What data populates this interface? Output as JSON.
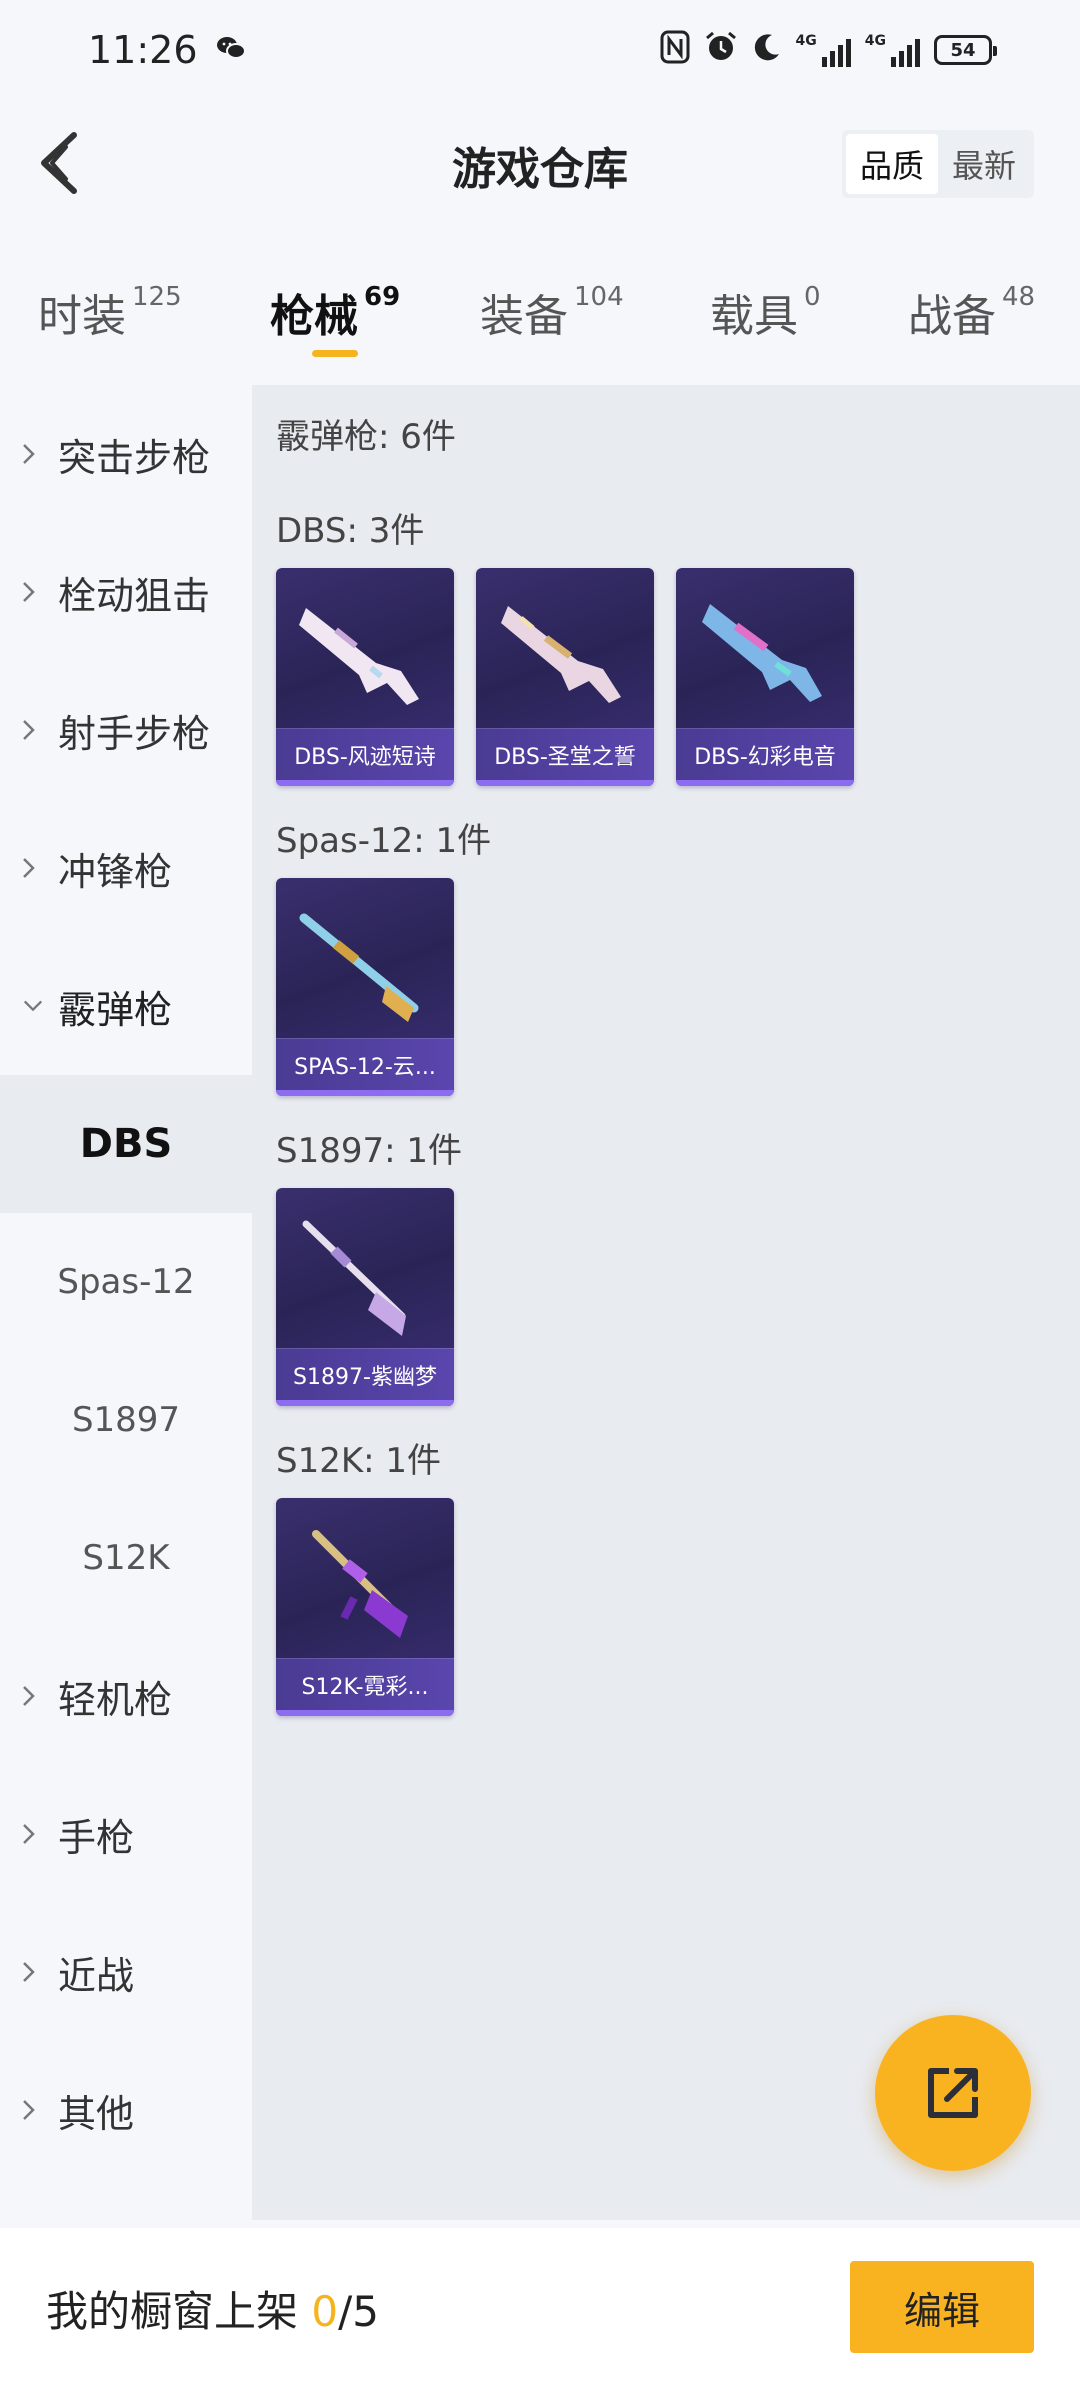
{
  "status_bar": {
    "time": "11:26",
    "battery": "54",
    "net1": "4G",
    "net2": "4G"
  },
  "header": {
    "title": "游戏仓库",
    "sort_options": [
      "品质",
      "最新"
    ],
    "sort_selected": "品质"
  },
  "tabs": [
    {
      "label": "时装",
      "count": "125"
    },
    {
      "label": "枪械",
      "count": "69"
    },
    {
      "label": "装备",
      "count": "104"
    },
    {
      "label": "载具",
      "count": "0"
    },
    {
      "label": "战备",
      "count": "48"
    }
  ],
  "active_tab": "枪械",
  "sidenav": {
    "categories": [
      "突击步枪",
      "栓动狙击",
      "射手步枪",
      "冲锋枪",
      "霰弹枪"
    ],
    "sub_items": [
      "DBS",
      "Spas-12",
      "S1897",
      "S12K"
    ],
    "categories_after": [
      "轻机枪",
      "手枪",
      "近战",
      "其他"
    ],
    "expanded": "霰弹枪",
    "selected_sub": "DBS"
  },
  "content": {
    "summary": "霰弹枪: 6件",
    "groups": [
      {
        "title": "DBS: 3件",
        "items": [
          "DBS-风迹短诗",
          "DBS-圣堂之誓",
          "DBS-幻彩电音"
        ]
      },
      {
        "title": "Spas-12: 1件",
        "items": [
          "SPAS-12-云..."
        ]
      },
      {
        "title": "S1897: 1件",
        "items": [
          "S1897-紫幽梦"
        ]
      },
      {
        "title": "S12K: 1件",
        "items": [
          "S12K-霓彩..."
        ]
      }
    ]
  },
  "showcase": {
    "label": "我的橱窗上架",
    "current": "0",
    "separator": "/",
    "max": "5",
    "edit_label": "编辑"
  },
  "icons": {
    "back": "chevron-left-icon",
    "share": "external-share-icon",
    "nav_chevron": "chevron-right-icon"
  },
  "colors": {
    "accent": "#f9b320",
    "card_bg": "#2f2862",
    "card_label": "#4f3fa0"
  }
}
